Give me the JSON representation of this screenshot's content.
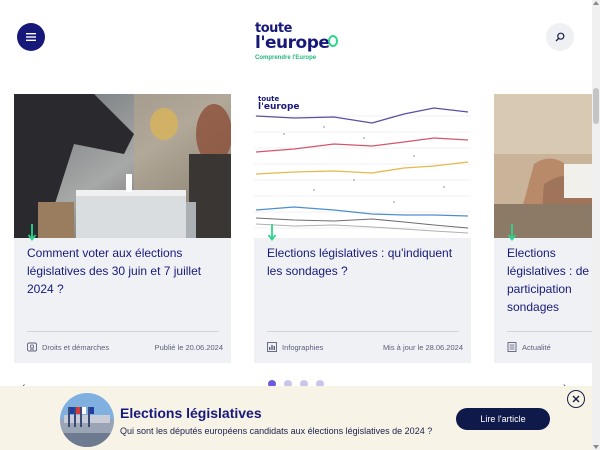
{
  "header": {
    "logo_line1": "toute",
    "logo_line2": "l'europe",
    "logo_tagline": "Comprendre l'Europe",
    "menu_icon": "hamburger-icon",
    "search_icon": "search-icon"
  },
  "colors": {
    "brand_navy": "#17197a",
    "accent_green": "#2bd68c",
    "card_bg": "#f0f1f5",
    "banner_bg": "#f7f3e6",
    "dot_active": "#6a5be0",
    "dot_inactive": "#c9c6ee"
  },
  "cards": [
    {
      "title": "Comment voter aux élections législatives des 30 juin et 7 juillet 2024 ?",
      "category": "Droits et démarches",
      "category_icon": "id-card-icon",
      "date": "Publié le 20.06.2024",
      "image": "ballot-box-photo"
    },
    {
      "title": "Elections législatives : qu'indiquent les sondages ?",
      "category": "Infographies",
      "category_icon": "chart-icon",
      "date": "Mis à jour le 28.06.2024",
      "image": "polling-chart-graphic",
      "image_logo_line1": "toute",
      "image_logo_line2": "l'europe"
    },
    {
      "title": "Elections législatives : de participation sondages",
      "category": "Actualité",
      "category_icon": "newspaper-icon",
      "date": "",
      "image": "hands-voting-photo"
    }
  ],
  "carousel": {
    "dots": 4,
    "active_index": 0,
    "prev_label": "‹",
    "next_label": "›"
  },
  "banner": {
    "title": "Elections législatives",
    "subtitle": "Qui sont les députés européens candidats aux élections législatives de 2024 ?",
    "cta_label": "Lire l'article",
    "close_icon": "close-icon",
    "thumb": "european-parliament-photo"
  }
}
